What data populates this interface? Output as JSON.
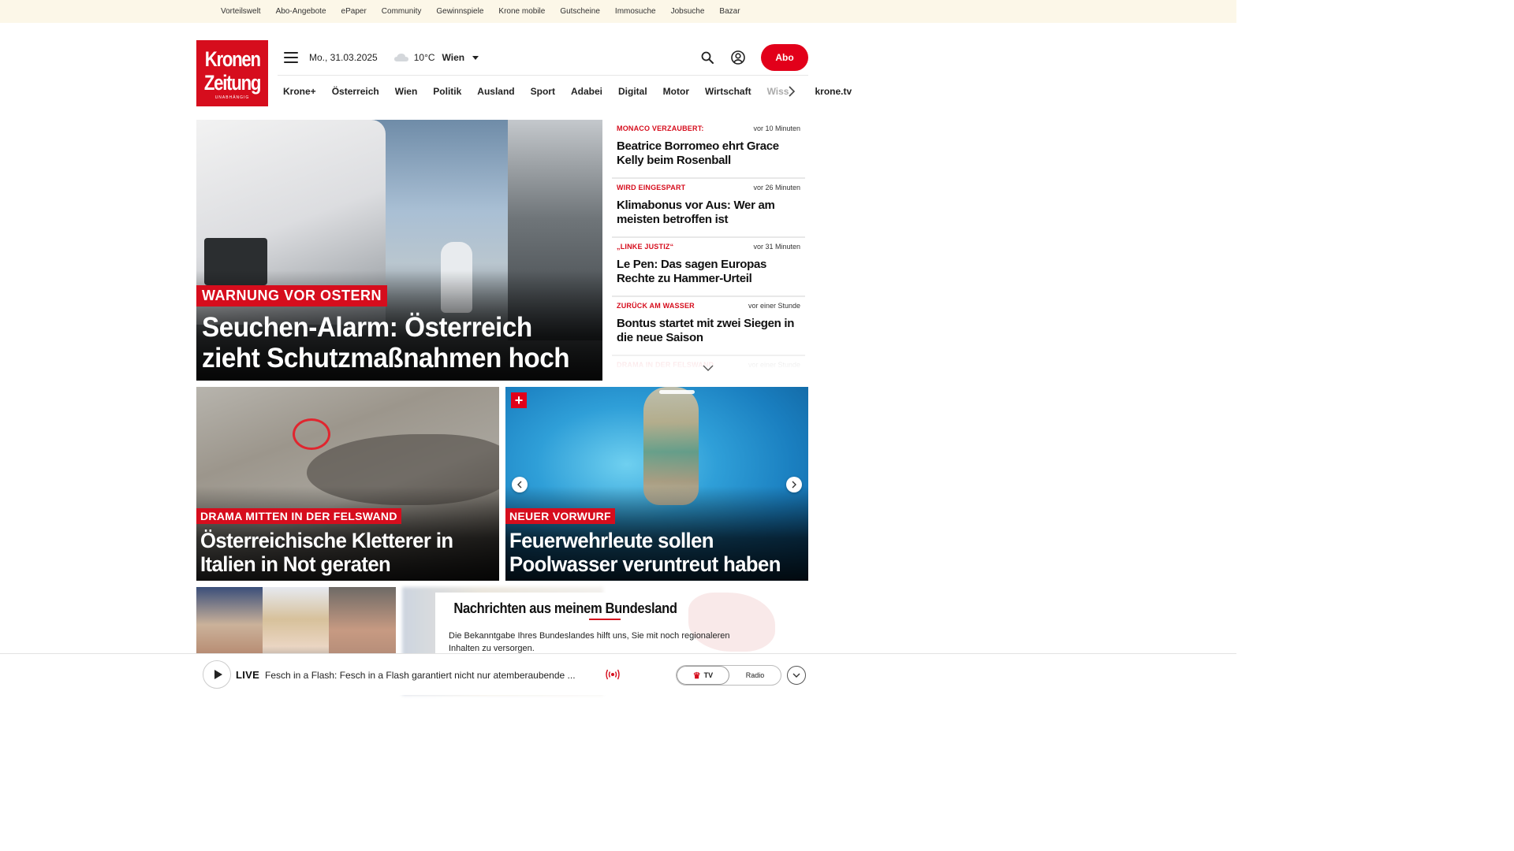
{
  "topbar": {
    "links": [
      "Vorteilswelt",
      "Abo-Angebote",
      "ePaper",
      "Community",
      "Gewinnspiele",
      "Krone mobile",
      "Gutscheine",
      "Immosuche",
      "Jobsuche",
      "Bazar"
    ]
  },
  "brand": {
    "line1": "Kronen",
    "line2": "Zeitung",
    "tagline": "UNABHÄNGIG",
    "color": "#d60d1d"
  },
  "header": {
    "date": "Mo., 31.03.2025",
    "temperature": "10°C",
    "city": "Wien",
    "weather_icon": "cloud-icon",
    "abo_label": "Abo"
  },
  "nav": {
    "items": [
      "Krone+",
      "Österreich",
      "Wien",
      "Politik",
      "Ausland",
      "Sport",
      "Adabei",
      "Digital",
      "Motor",
      "Wirtschaft",
      "Wiss"
    ],
    "tv_label": "krone.tv"
  },
  "hero": {
    "kicker": "WARNUNG VOR OSTERN",
    "title": "Seuchen-Alarm: Österreich zieht Schutzmaßnahmen hoch"
  },
  "side_news": [
    {
      "kicker": "MONACO VERZAUBERT:",
      "time": "vor 10 Minuten",
      "title": "Beatrice Borromeo ehrt Grace Kelly beim Rosenball"
    },
    {
      "kicker": "WIRD EINGESPART",
      "time": "vor 26 Minuten",
      "title": "Klimabonus vor Aus: Wer am meisten betroffen ist"
    },
    {
      "kicker": "„LINKE JUSTIZ“",
      "time": "vor 31 Minuten",
      "title": "Le Pen: Das sagen Europas Rechte zu Hammer-Urteil"
    },
    {
      "kicker": "ZURÜCK AM WASSER",
      "time": "vor einer Stunde",
      "title": "Bontus startet mit zwei Siegen in die neue Saison"
    },
    {
      "kicker": "DRAMA IN DER FELSWAND",
      "time": "vor einer Stunde",
      "title": ""
    }
  ],
  "tiles": [
    {
      "kicker": "DRAMA MITTEN IN DER FELSWAND",
      "title": "Österreichische Kletterer in Italien in Not geraten"
    },
    {
      "kicker": "NEUER VORWURF",
      "title": "Feuerwehrleute sollen Poolwasser veruntreut haben",
      "badge": "+"
    }
  ],
  "bundesland": {
    "title": "Nachrichten aus meinem Bundesland",
    "text": "Die Bekanntgabe Ihres Bundeslandes hilft uns, Sie mit noch regionaleren Inhalten zu versorgen."
  },
  "player": {
    "live_label": "LIVE",
    "title": "Fesch in a Flash: Fesch in a Flash garantiert nicht nur atemberaubende ...",
    "tv_label": "TV",
    "radio_label": "Radio"
  }
}
